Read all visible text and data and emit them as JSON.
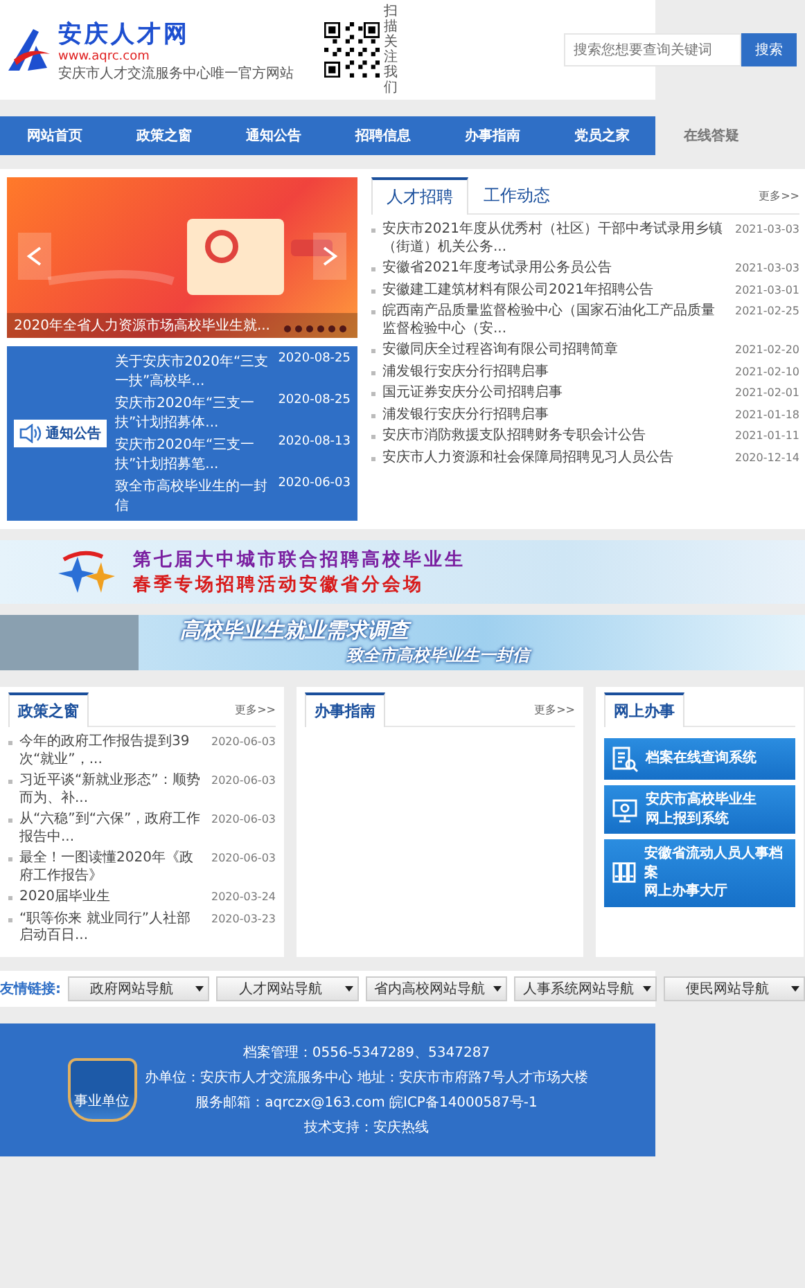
{
  "header": {
    "logo": {
      "title": "安庆人才网",
      "url": "www.aqrc.com",
      "slogan": "安庆市人才交流服务中心唯一官方网站"
    },
    "qr_caption": "扫描关注我们",
    "search": {
      "placeholder": "搜索您想要查询关键词",
      "button": "搜索"
    }
  },
  "nav": [
    {
      "label": "网站首页"
    },
    {
      "label": "政策之窗"
    },
    {
      "label": "通知公告"
    },
    {
      "label": "招聘信息"
    },
    {
      "label": "办事指南"
    },
    {
      "label": "党员之家"
    },
    {
      "label": "在线答疑"
    }
  ],
  "carousel": {
    "caption": "2020年全省人力资源市场高校毕业生就..."
  },
  "notices": {
    "label": "通知公告",
    "items": [
      {
        "title": "关于安庆市2020年“三支一扶”高校毕...",
        "date": "2020-08-25"
      },
      {
        "title": "安庆市2020年“三支一扶”计划招募体...",
        "date": "2020-08-25"
      },
      {
        "title": "安庆市2020年“三支一扶”计划招募笔...",
        "date": "2020-08-13"
      },
      {
        "title": "致全市高校毕业生的一封信",
        "date": "2020-06-03"
      }
    ]
  },
  "news": {
    "tabs": [
      {
        "label": "人才招聘",
        "selected": true
      },
      {
        "label": "工作动态",
        "selected": false
      }
    ],
    "more": "更多>>",
    "items": [
      {
        "title": "安庆市2021年度从优秀村（社区）干部中考试录用乡镇（街道）机关公务...",
        "date": "2021-03-03"
      },
      {
        "title": "安徽省2021年度考试录用公务员公告",
        "date": "2021-03-03"
      },
      {
        "title": "安徽建工建筑材料有限公司2021年招聘公告",
        "date": "2021-03-01"
      },
      {
        "title": "皖西南产品质量监督检验中心（国家石油化工产品质量监督检验中心（安...",
        "date": "2021-02-25"
      },
      {
        "title": "安徽同庆全过程咨询有限公司招聘简章",
        "date": "2021-02-20"
      },
      {
        "title": "浦发银行安庆分行招聘启事",
        "date": "2021-02-10"
      },
      {
        "title": "国元证券安庆分公司招聘启事",
        "date": "2021-02-01"
      },
      {
        "title": "浦发银行安庆分行招聘启事",
        "date": "2021-01-18"
      },
      {
        "title": "安庆市消防救援支队招聘财务专职会计公告",
        "date": "2021-01-11"
      },
      {
        "title": "安庆市人力资源和社会保障局招聘见习人员公告",
        "date": "2020-12-14"
      }
    ]
  },
  "banners": [
    {
      "kind": "fair",
      "lines": [
        "第七届大中城市联合招聘高校毕业生",
        "春季专场招聘活动安徽省分会场"
      ]
    },
    {
      "kind": "survey",
      "lines": [
        "高校毕业生就业需求调查",
        "致全市高校毕业生一封信"
      ]
    }
  ],
  "panels": {
    "policy": {
      "title": "政策之窗",
      "more": "更多>>",
      "items": [
        {
          "title": "今年的政府工作报告提到39次“就业”，...",
          "date": "2020-06-03"
        },
        {
          "title": "习近平谈“新就业形态”：顺势而为、补...",
          "date": "2020-06-03"
        },
        {
          "title": "从“六稳”到“六保”，政府工作报告中...",
          "date": "2020-06-03"
        },
        {
          "title": "最全！一图读懂2020年《政府工作报告》",
          "date": "2020-06-03"
        },
        {
          "title": "2020届毕业生",
          "date": "2020-03-24"
        },
        {
          "title": "“职等你来 就业同行”人社部启动百日...",
          "date": "2020-03-23"
        }
      ]
    },
    "guide": {
      "title": "办事指南",
      "more": "更多>>"
    },
    "online": {
      "title": "网上办事",
      "services": [
        {
          "kind": "archive-search",
          "lines": [
            "档案在线查询系统"
          ]
        },
        {
          "kind": "graduate-report",
          "lines": [
            "安庆市高校毕业生",
            "网上报到系统"
          ]
        },
        {
          "kind": "archive-hall",
          "lines": [
            "安徽省流动人员人事档案",
            "网上办事大厅"
          ]
        }
      ]
    }
  },
  "links": {
    "label": "友情链接:",
    "selects": [
      "政府网站导航",
      "人才网站导航",
      "省内高校网站导航",
      "人事系统网站导航",
      "便民网站导航"
    ]
  },
  "footer": {
    "badge": "事业单位",
    "lines": [
      "档案管理：0556-5347289、5347287",
      "办单位：安庆市人才交流服务中心 地址：安庆市市府路7号人才市场大楼",
      "服务邮箱：aqrczx@163.com 皖ICP备14000587号-1",
      "技术支持：安庆热线"
    ]
  }
}
